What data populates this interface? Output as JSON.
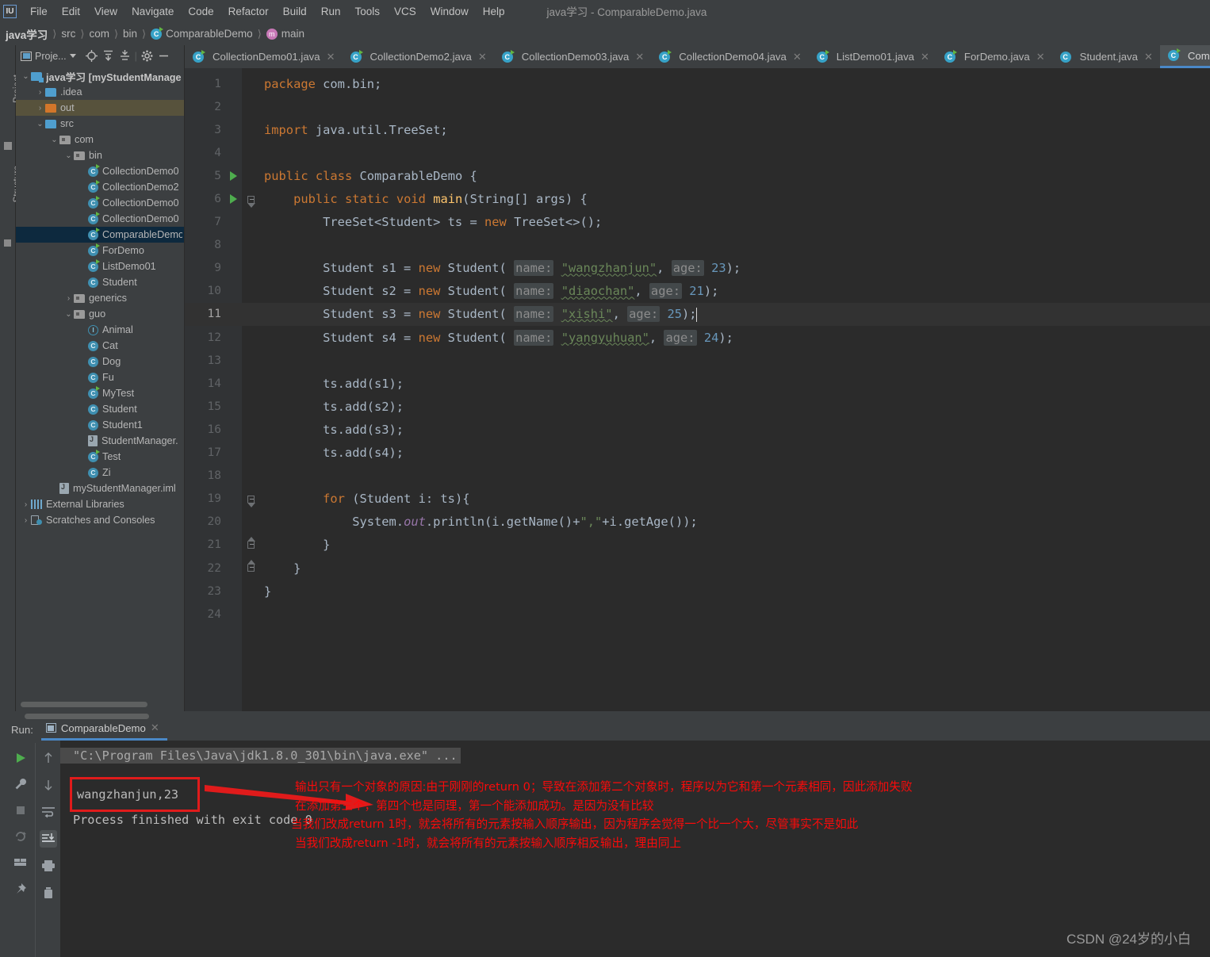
{
  "app": {
    "logo_text": "IU",
    "window_title": "java学习 - ComparableDemo.java"
  },
  "menu": {
    "items": [
      {
        "label": "File"
      },
      {
        "label": "Edit"
      },
      {
        "label": "View"
      },
      {
        "label": "Navigate"
      },
      {
        "label": "Code"
      },
      {
        "label": "Refactor"
      },
      {
        "label": "Build"
      },
      {
        "label": "Run"
      },
      {
        "label": "Tools"
      },
      {
        "label": "VCS"
      },
      {
        "label": "Window"
      },
      {
        "label": "Help"
      }
    ]
  },
  "breadcrumb": {
    "items": [
      {
        "label": "java学习",
        "icon": ""
      },
      {
        "label": "src",
        "icon": ""
      },
      {
        "label": "com",
        "icon": ""
      },
      {
        "label": "bin",
        "icon": ""
      },
      {
        "label": "ComparableDemo",
        "icon": "class-icon"
      },
      {
        "label": "main",
        "icon": "method-icon"
      }
    ]
  },
  "left_strip": {
    "project_label": "Project",
    "structure_label": "Structure"
  },
  "project_panel": {
    "title": "Proje...",
    "toolbar_icons": [
      "locate-icon",
      "expand-all-icon",
      "collapse-all-icon",
      "gear-icon",
      "hide-icon"
    ],
    "tree": [
      {
        "depth": 0,
        "chev": "v",
        "icon": "folder-module",
        "label": "java学习 [myStudentManage",
        "bold": true,
        "state": "none"
      },
      {
        "depth": 1,
        "chev": ">",
        "icon": "folder-blue",
        "label": ".idea",
        "bold": false,
        "state": "none"
      },
      {
        "depth": 1,
        "chev": ">",
        "icon": "folder-orange",
        "label": "out",
        "bold": false,
        "state": "out"
      },
      {
        "depth": 1,
        "chev": "v",
        "icon": "folder-src",
        "label": "src",
        "bold": false,
        "state": "none"
      },
      {
        "depth": 2,
        "chev": "v",
        "icon": "folder-pkg",
        "label": "com",
        "bold": false,
        "state": "none"
      },
      {
        "depth": 3,
        "chev": "v",
        "icon": "folder-pkg",
        "label": "bin",
        "bold": false,
        "state": "none"
      },
      {
        "depth": 4,
        "chev": "",
        "icon": "class-run",
        "label": "CollectionDemo0",
        "bold": false,
        "state": "none"
      },
      {
        "depth": 4,
        "chev": "",
        "icon": "class-run",
        "label": "CollectionDemo2",
        "bold": false,
        "state": "none"
      },
      {
        "depth": 4,
        "chev": "",
        "icon": "class-run",
        "label": "CollectionDemo0",
        "bold": false,
        "state": "none"
      },
      {
        "depth": 4,
        "chev": "",
        "icon": "class-run",
        "label": "CollectionDemo0",
        "bold": false,
        "state": "none"
      },
      {
        "depth": 4,
        "chev": "",
        "icon": "class-run",
        "label": "ComparableDemo",
        "bold": false,
        "state": "selected"
      },
      {
        "depth": 4,
        "chev": "",
        "icon": "class-run",
        "label": "ForDemo",
        "bold": false,
        "state": "none"
      },
      {
        "depth": 4,
        "chev": "",
        "icon": "class-run",
        "label": "ListDemo01",
        "bold": false,
        "state": "none"
      },
      {
        "depth": 4,
        "chev": "",
        "icon": "class",
        "label": "Student",
        "bold": false,
        "state": "none"
      },
      {
        "depth": 3,
        "chev": ">",
        "icon": "folder-pkg",
        "label": "generics",
        "bold": false,
        "state": "none"
      },
      {
        "depth": 3,
        "chev": "v",
        "icon": "folder-pkg",
        "label": "guo",
        "bold": false,
        "state": "none"
      },
      {
        "depth": 4,
        "chev": "",
        "icon": "interface",
        "label": "Animal",
        "bold": false,
        "state": "none"
      },
      {
        "depth": 4,
        "chev": "",
        "icon": "class",
        "label": "Cat",
        "bold": false,
        "state": "none"
      },
      {
        "depth": 4,
        "chev": "",
        "icon": "class",
        "label": "Dog",
        "bold": false,
        "state": "none"
      },
      {
        "depth": 4,
        "chev": "",
        "icon": "class",
        "label": "Fu",
        "bold": false,
        "state": "none"
      },
      {
        "depth": 4,
        "chev": "",
        "icon": "class-run",
        "label": "MyTest",
        "bold": false,
        "state": "none"
      },
      {
        "depth": 4,
        "chev": "",
        "icon": "class",
        "label": "Student",
        "bold": false,
        "state": "none"
      },
      {
        "depth": 4,
        "chev": "",
        "icon": "class",
        "label": "Student1",
        "bold": false,
        "state": "none"
      },
      {
        "depth": 4,
        "chev": "",
        "icon": "file-java",
        "label": "StudentManager.",
        "bold": false,
        "state": "none"
      },
      {
        "depth": 4,
        "chev": "",
        "icon": "class-run",
        "label": "Test",
        "bold": false,
        "state": "none"
      },
      {
        "depth": 4,
        "chev": "",
        "icon": "class",
        "label": "Zi",
        "bold": false,
        "state": "none"
      },
      {
        "depth": 2,
        "chev": "",
        "icon": "file-iml",
        "label": "myStudentManager.iml",
        "bold": false,
        "state": "none"
      },
      {
        "depth": 0,
        "chev": ">",
        "icon": "library",
        "label": "External Libraries",
        "bold": false,
        "state": "none"
      },
      {
        "depth": 0,
        "chev": ">",
        "icon": "scratches",
        "label": "Scratches and Consoles",
        "bold": false,
        "state": "none"
      }
    ]
  },
  "editor_tabs": [
    {
      "label": "CollectionDemo01.java",
      "icon": "class-run-icon",
      "active": false
    },
    {
      "label": "CollectionDemo2.java",
      "icon": "class-run-icon",
      "active": false
    },
    {
      "label": "CollectionDemo03.java",
      "icon": "class-run-icon",
      "active": false
    },
    {
      "label": "CollectionDemo04.java",
      "icon": "class-run-icon",
      "active": false
    },
    {
      "label": "ListDemo01.java",
      "icon": "class-run-icon",
      "active": false
    },
    {
      "label": "ForDemo.java",
      "icon": "class-run-icon",
      "active": false
    },
    {
      "label": "Student.java",
      "icon": "class-icon",
      "active": false
    },
    {
      "label": "ComparableDem",
      "icon": "class-run-icon",
      "active": true
    }
  ],
  "editor": {
    "current_line": 11,
    "lines": [
      {
        "n": "1",
        "gutter": "",
        "text": "package com.bin;"
      },
      {
        "n": "2",
        "gutter": "",
        "text": ""
      },
      {
        "n": "3",
        "gutter": "",
        "text": "import java.util.TreeSet;"
      },
      {
        "n": "4",
        "gutter": "",
        "text": ""
      },
      {
        "n": "5",
        "gutter": "run",
        "text": "public class ComparableDemo {"
      },
      {
        "n": "6",
        "gutter": "run-fold",
        "text": "    public static void main(String[] args) {"
      },
      {
        "n": "7",
        "gutter": "",
        "text": "        TreeSet<Student> ts = new TreeSet<>();"
      },
      {
        "n": "8",
        "gutter": "",
        "text": ""
      },
      {
        "n": "9",
        "gutter": "",
        "text": "        Student s1 = new Student( name: \"wangzhanjun\", age: 23);"
      },
      {
        "n": "10",
        "gutter": "",
        "text": "        Student s2 = new Student( name: \"diaochan\", age: 21);"
      },
      {
        "n": "11",
        "gutter": "",
        "text": "        Student s3 = new Student( name: \"xishi\", age: 25);"
      },
      {
        "n": "12",
        "gutter": "",
        "text": "        Student s4 = new Student( name: \"yangyuhuan\", age: 24);"
      },
      {
        "n": "13",
        "gutter": "",
        "text": ""
      },
      {
        "n": "14",
        "gutter": "",
        "text": "        ts.add(s1);"
      },
      {
        "n": "15",
        "gutter": "",
        "text": "        ts.add(s2);"
      },
      {
        "n": "16",
        "gutter": "",
        "text": "        ts.add(s3);"
      },
      {
        "n": "17",
        "gutter": "",
        "text": "        ts.add(s4);"
      },
      {
        "n": "18",
        "gutter": "",
        "text": ""
      },
      {
        "n": "19",
        "gutter": "fold-tip",
        "text": "        for (Student i: ts){"
      },
      {
        "n": "20",
        "gutter": "",
        "text": "            System.out.println(i.getName()+\",\"+i.getAge());"
      },
      {
        "n": "21",
        "gutter": "fold-end",
        "text": "        }"
      },
      {
        "n": "22",
        "gutter": "fold-end",
        "text": "    }"
      },
      {
        "n": "23",
        "gutter": "",
        "text": "}"
      },
      {
        "n": "24",
        "gutter": "",
        "text": ""
      }
    ]
  },
  "run_panel": {
    "run_label": "Run:",
    "tab_label": "ComparableDemo",
    "toolbar_left": [
      "run-icon",
      "wrench-icon",
      "stop-icon",
      "rerun-failed-icon",
      "layout-icon",
      "pin-icon"
    ],
    "toolbar_right": [
      "up-arrow-icon",
      "down-arrow-icon",
      "soft-wrap-icon",
      "scroll-to-end-icon",
      "print-icon",
      "trash-icon"
    ],
    "console": {
      "command_line": "\"C:\\Program Files\\Java\\jdk1.8.0_301\\bin\\java.exe\" ...",
      "output_line": "wangzhanjun,23",
      "exit_line": "Process finished with exit code 0"
    },
    "annotations": [
      "输出只有一个对象的原因:由于刚刚的return 0；导致在添加第二个对象时，程序以为它和第一个元素相同，因此添加失败",
      "在添加第三个，第四个也是同理，第一个能添加成功。是因为没有比较",
      "当我们改成return 1时，就会将所有的元素按输入顺序输出，因为程序会觉得一个比一个大，尽管事实不是如此",
      "当我们改成return  -1时，就会将所有的元素按输入顺序相反输出，理由同上"
    ],
    "annotation_color": "#fb0a0a",
    "highlight_box_color": "#e01b1b"
  },
  "watermark": "CSDN @24岁的小白"
}
